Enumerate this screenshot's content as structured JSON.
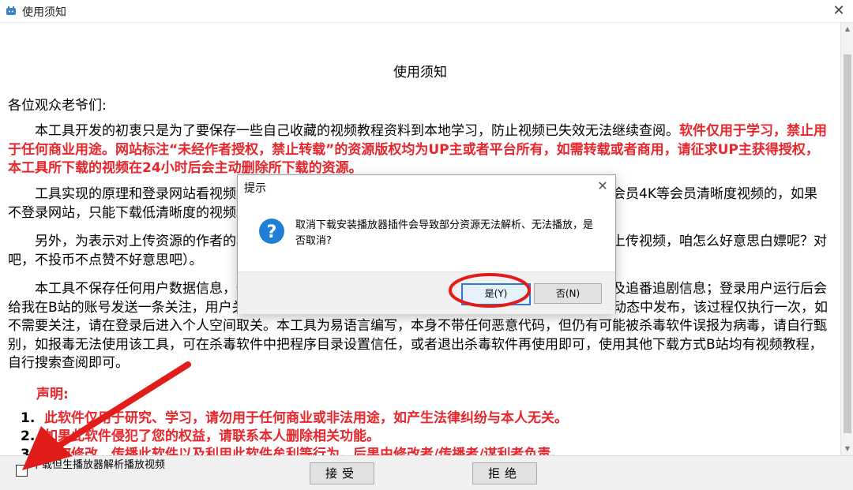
{
  "window": {
    "title": "使用须知",
    "close_glyph": "✕"
  },
  "document": {
    "heading": "使用须知",
    "greeting": "各位观众老爷们:",
    "p1_normal": "本工具开发的初衷只是为了要保存一些自己收藏的视频教程资料到本地学习，防止视频已失效无法继续查阅。",
    "p1_red": "软件仅用于学习，禁止用于任何商业用途。网站标注“未经作者授权，禁止转载”的资源版权均为UP主或者平台所有，如需转载或者商用，请征求UP主获得授权，本工具所下载的视频在24小时后会主动删除所下载的资源。",
    "p2": "工具实现的原理和登录网站看视频是一样的，你是会员就可以下载会员的视频，非会员不可以下载会员4K等会员清晰度视频的，如果不登录网站，只能下载低清晰度的视频。",
    "p3": "另外，为表示对上传资源的作者的尊重，下载之前，请给作者一键三连点赞（按理说别人辛苦制作上传视频，咱怎么好意思白嫖呢？对吧，不投币不点赞不好意思吧）。",
    "p4": "本工具不保存任何用户数据信息，仅用于获取用户信息，显示用户头像等信息，及获取用户收藏夹及追番追剧信息；登录用户运行后会给我在B站的账号发送一条关注，用户关注了我的B站账号，以后程序有更新会第一时间再B站个人空间动态中发布，该过程仅执行一次，如不需要关注，请在登录后进入个人空间取关。本工具为易语言编写，本身不带任何恶意代码，但仍有可能被杀毒软件误报为病毒，请自行甄别，如报毒无法使用该工具，可在杀毒软件中把程序目录设置信任，或者退出杀毒软件再使用即可，使用其他下载方式B站均有视频教程，自行搜索查阅即可。",
    "declaration_heading": "声明:",
    "declarations": [
      {
        "num": "1.",
        "text": "此软件仅用于研究、学习，请勿用于任何商业或非法用途，如产生法律纠纷与本人无关。"
      },
      {
        "num": "2.",
        "text": "如果此软件侵犯了您的权益，请联系本人删除相关功能。"
      },
      {
        "num": "3.",
        "text": "任何修改、传播此软件以及利用此软件牟利等行为，后果由修改者/传播者/谋利者负责。"
      }
    ]
  },
  "footer": {
    "checkbox_label": "下载但生播放器解析播放视频",
    "accept_label": "接受",
    "reject_label": "拒绝"
  },
  "dialog": {
    "title": "提示",
    "close_glyph": "✕",
    "message": "取消下载安装播放器插件会导致部分资源无法解析、无法播放，是否取消?",
    "yes_label": "是(Y)",
    "no_label": "否(N)",
    "icon": "question-icon"
  },
  "colors": {
    "red_text": "#e8262b",
    "annotation_red": "#e21b1b",
    "question_blue": "#1f7fd6"
  }
}
